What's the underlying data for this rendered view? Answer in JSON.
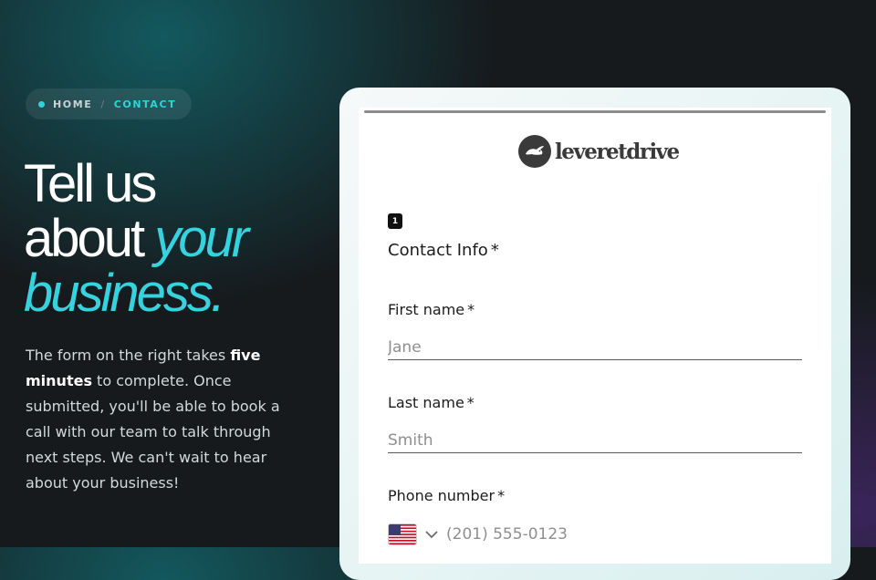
{
  "breadcrumb": {
    "home": "HOME",
    "separator": "/",
    "current": "CONTACT"
  },
  "headline": {
    "line1": "Tell us",
    "line2_plain": "about ",
    "line2_accent": "your",
    "line3_accent": "business."
  },
  "description": {
    "part1": "The form on the right takes ",
    "bold": "five minutes",
    "part2": " to complete. Once submitted, you'll be able to book a call with our team to talk through next steps. We can't wait to hear about your business!"
  },
  "form": {
    "logo_text": "leveretdrive",
    "step_number": "1",
    "section_title": "Contact Info",
    "required_marker": "*",
    "first_name": {
      "label": "First name",
      "placeholder": "Jane"
    },
    "last_name": {
      "label": "Last name",
      "placeholder": "Smith"
    },
    "phone": {
      "label": "Phone number",
      "placeholder": "(201) 555-0123",
      "country_icon": "us-flag-icon"
    }
  },
  "colors": {
    "accent": "#2fd4da",
    "background": "#161a1d",
    "card": "#ffffff"
  }
}
